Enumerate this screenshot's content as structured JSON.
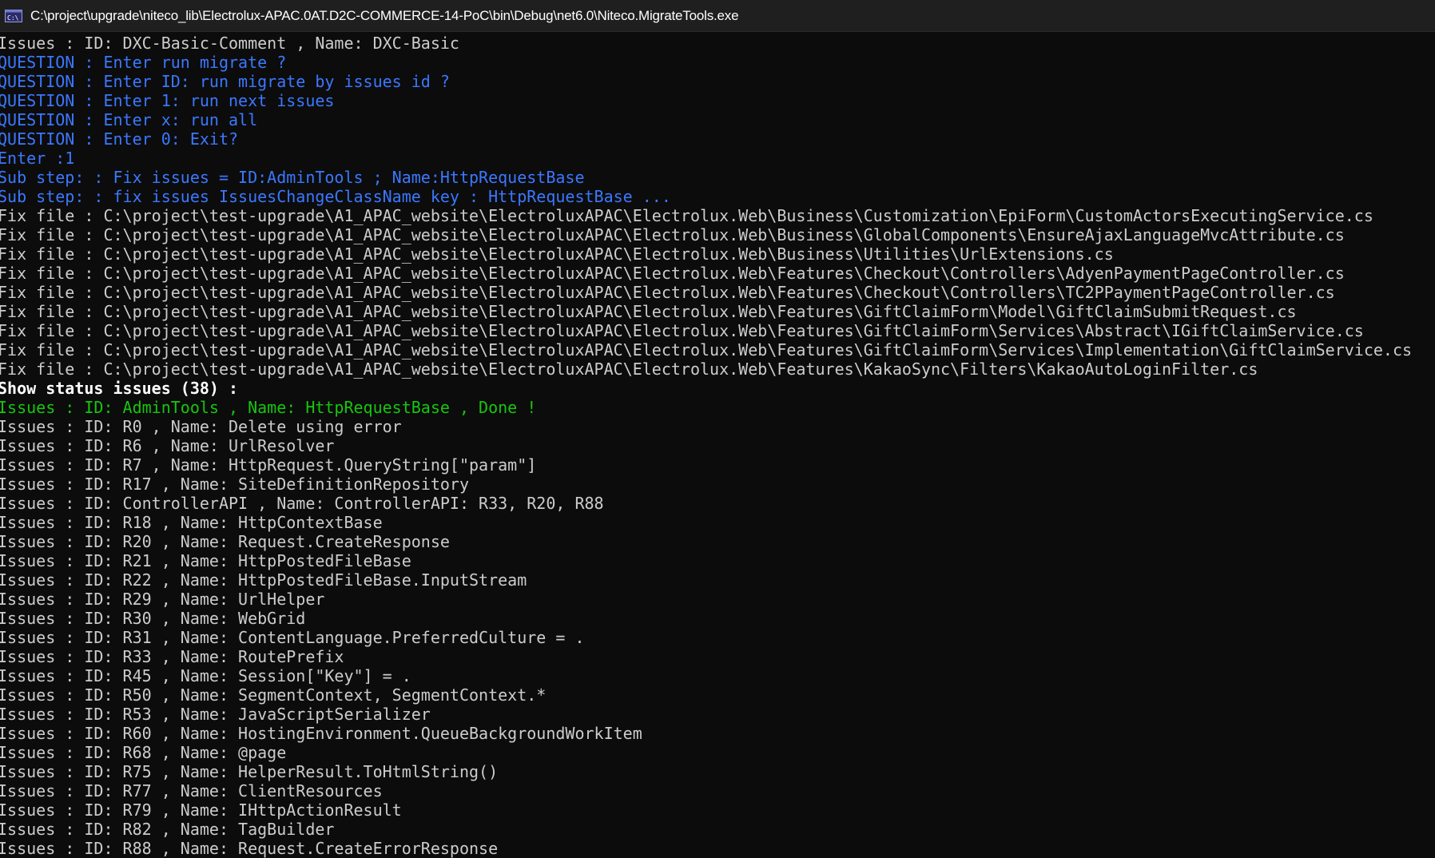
{
  "window": {
    "title": "C:\\project\\upgrade\\niteco_lib\\Electrolux-APAC.0AT.D2C-COMMERCE-14-PoC\\bin\\Debug\\net6.0\\Niteco.MigrateTools.exe",
    "icon": "console-icon"
  },
  "colors": {
    "background": "#0c0c0c",
    "default_text": "#cccccc",
    "question_blue": "#3b78ff",
    "done_green": "#16c60c"
  },
  "console": {
    "lines": [
      {
        "text": "Issues : ID: DXC-Basic-Comment , Name: DXC-Basic",
        "style": "gray"
      },
      {
        "text": "QUESTION : Enter run migrate ?",
        "style": "blue"
      },
      {
        "text": "QUESTION : Enter ID: run migrate by issues id ?",
        "style": "blue"
      },
      {
        "text": "QUESTION : Enter 1: run next issues",
        "style": "blue"
      },
      {
        "text": "QUESTION : Enter x: run all",
        "style": "blue"
      },
      {
        "text": "QUESTION : Enter 0: Exit?",
        "style": "blue"
      },
      {
        "text": "Enter :1",
        "style": "blue"
      },
      {
        "text": "Sub step: : Fix issues = ID:AdminTools ; Name:HttpRequestBase",
        "style": "blue"
      },
      {
        "text": "Sub step: : fix issues IssuesChangeClassName key : HttpRequestBase ...",
        "style": "blue"
      },
      {
        "text": "Fix file : C:\\project\\test-upgrade\\A1_APAC_website\\ElectroluxAPAC\\Electrolux.Web\\Business\\Customization\\EpiForm\\CustomActorsExecutingService.cs",
        "style": "gray"
      },
      {
        "text": "Fix file : C:\\project\\test-upgrade\\A1_APAC_website\\ElectroluxAPAC\\Electrolux.Web\\Business\\GlobalComponents\\EnsureAjaxLanguageMvcAttribute.cs",
        "style": "gray"
      },
      {
        "text": "Fix file : C:\\project\\test-upgrade\\A1_APAC_website\\ElectroluxAPAC\\Electrolux.Web\\Business\\Utilities\\UrlExtensions.cs",
        "style": "gray"
      },
      {
        "text": "Fix file : C:\\project\\test-upgrade\\A1_APAC_website\\ElectroluxAPAC\\Electrolux.Web\\Features\\Checkout\\Controllers\\AdyenPaymentPageController.cs",
        "style": "gray"
      },
      {
        "text": "Fix file : C:\\project\\test-upgrade\\A1_APAC_website\\ElectroluxAPAC\\Electrolux.Web\\Features\\Checkout\\Controllers\\TC2PPaymentPageController.cs",
        "style": "gray"
      },
      {
        "text": "Fix file : C:\\project\\test-upgrade\\A1_APAC_website\\ElectroluxAPAC\\Electrolux.Web\\Features\\GiftClaimForm\\Model\\GiftClaimSubmitRequest.cs",
        "style": "gray"
      },
      {
        "text": "Fix file : C:\\project\\test-upgrade\\A1_APAC_website\\ElectroluxAPAC\\Electrolux.Web\\Features\\GiftClaimForm\\Services\\Abstract\\IGiftClaimService.cs",
        "style": "gray"
      },
      {
        "text": "Fix file : C:\\project\\test-upgrade\\A1_APAC_website\\ElectroluxAPAC\\Electrolux.Web\\Features\\GiftClaimForm\\Services\\Implementation\\GiftClaimService.cs",
        "style": "gray"
      },
      {
        "text": "Fix file : C:\\project\\test-upgrade\\A1_APAC_website\\ElectroluxAPAC\\Electrolux.Web\\Features\\KakaoSync\\Filters\\KakaoAutoLoginFilter.cs",
        "style": "gray"
      },
      {
        "text": "Show status issues (38) :",
        "style": "bright"
      },
      {
        "text": "Issues : ID: AdminTools , Name: HttpRequestBase , Done !",
        "style": "green"
      },
      {
        "text": "Issues : ID: R0 , Name: Delete using error",
        "style": "gray"
      },
      {
        "text": "Issues : ID: R6 , Name: UrlResolver",
        "style": "gray"
      },
      {
        "text": "Issues : ID: R7 , Name: HttpRequest.QueryString[\"param\"]",
        "style": "gray"
      },
      {
        "text": "Issues : ID: R17 , Name: SiteDefinitionRepository",
        "style": "gray"
      },
      {
        "text": "Issues : ID: ControllerAPI , Name: ControllerAPI: R33, R20, R88",
        "style": "gray"
      },
      {
        "text": "Issues : ID: R18 , Name: HttpContextBase",
        "style": "gray"
      },
      {
        "text": "Issues : ID: R20 , Name: Request.CreateResponse",
        "style": "gray"
      },
      {
        "text": "Issues : ID: R21 , Name: HttpPostedFileBase",
        "style": "gray"
      },
      {
        "text": "Issues : ID: R22 , Name: HttpPostedFileBase.InputStream",
        "style": "gray"
      },
      {
        "text": "Issues : ID: R29 , Name: UrlHelper",
        "style": "gray"
      },
      {
        "text": "Issues : ID: R30 , Name: WebGrid",
        "style": "gray"
      },
      {
        "text": "Issues : ID: R31 , Name: ContentLanguage.PreferredCulture = .",
        "style": "gray"
      },
      {
        "text": "Issues : ID: R33 , Name: RoutePrefix",
        "style": "gray"
      },
      {
        "text": "Issues : ID: R45 , Name: Session[\"Key\"] = .",
        "style": "gray"
      },
      {
        "text": "Issues : ID: R50 , Name: SegmentContext, SegmentContext.*",
        "style": "gray"
      },
      {
        "text": "Issues : ID: R53 , Name: JavaScriptSerializer",
        "style": "gray"
      },
      {
        "text": "Issues : ID: R60 , Name: HostingEnvironment.QueueBackgroundWorkItem",
        "style": "gray"
      },
      {
        "text": "Issues : ID: R68 , Name: @page",
        "style": "gray"
      },
      {
        "text": "Issues : ID: R75 , Name: HelperResult.ToHtmlString()",
        "style": "gray"
      },
      {
        "text": "Issues : ID: R77 , Name: ClientResources",
        "style": "gray"
      },
      {
        "text": "Issues : ID: R79 , Name: IHttpActionResult",
        "style": "gray"
      },
      {
        "text": "Issues : ID: R82 , Name: TagBuilder",
        "style": "gray"
      },
      {
        "text": "Issues : ID: R88 , Name: Request.CreateErrorResponse",
        "style": "gray"
      }
    ]
  }
}
